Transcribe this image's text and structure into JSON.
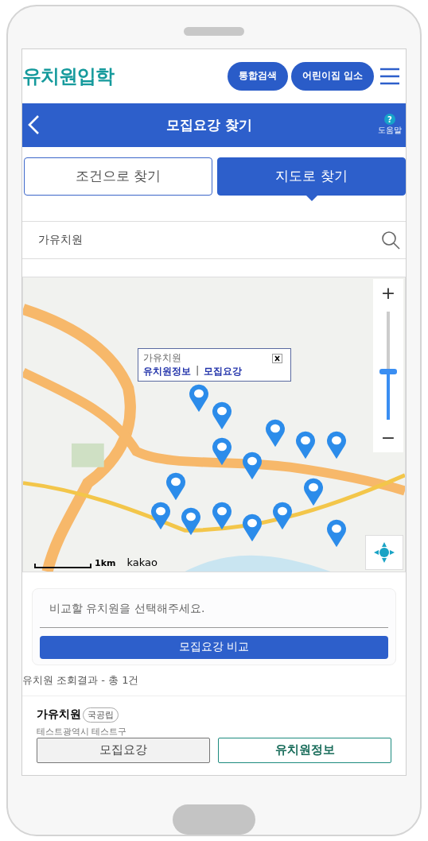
{
  "header": {
    "logo": "유치원입학",
    "buttons": [
      "통합검색",
      "어린이집 입소"
    ]
  },
  "title_bar": {
    "title": "모집요강 찾기",
    "help_icon": "?",
    "help": "도움말"
  },
  "tabs": [
    {
      "label": "조건으로 찾기",
      "selected": false
    },
    {
      "label": "지도로 찾기",
      "selected": true
    }
  ],
  "search": {
    "value": "가유치원"
  },
  "map": {
    "popup": {
      "name": "가유치원",
      "links": [
        "유치원정보",
        "모집요강"
      ],
      "separator": "|"
    },
    "zoom_in": "+",
    "zoom_out": "−",
    "zoom": {
      "level": 0.45
    },
    "scale": "1km",
    "credit": "kakao"
  },
  "compare": {
    "placeholder": "비교할 유치원을 선택해주세요.",
    "button": "모집요강 비교"
  },
  "results": {
    "summary": "유치원 조회결과 - 총 1건",
    "items": [
      {
        "name": "가유치원",
        "badge": "국공립",
        "address": "테스트광역시 테스트구",
        "buttons": [
          "모집요강",
          "유치원정보"
        ]
      }
    ]
  }
}
